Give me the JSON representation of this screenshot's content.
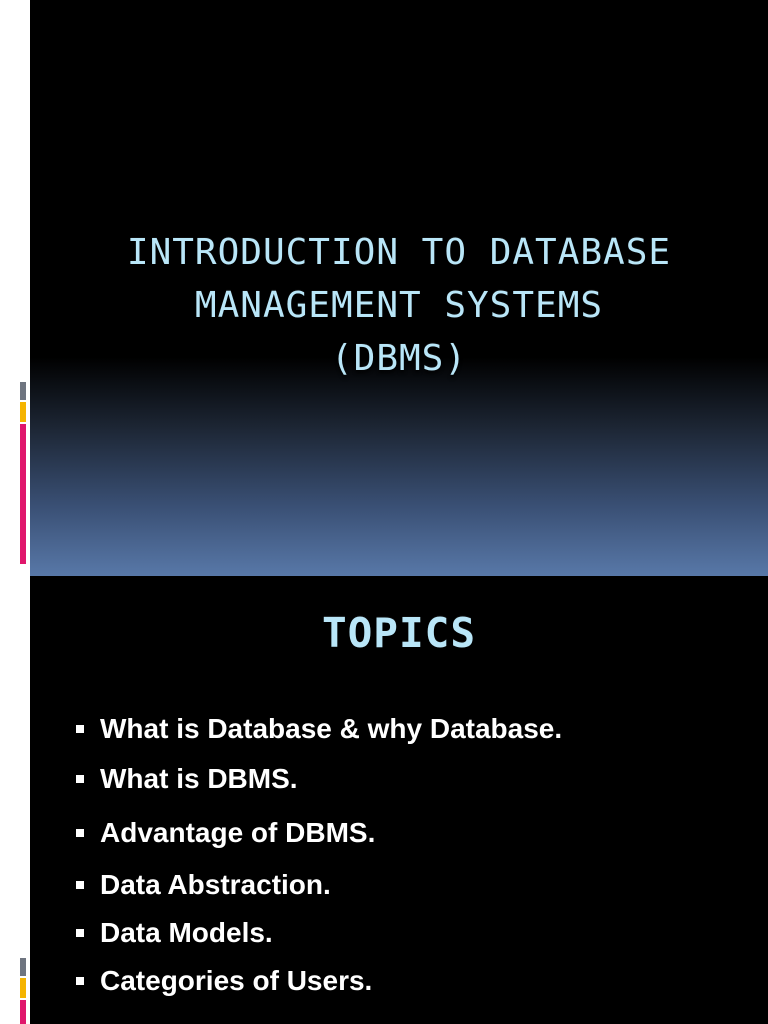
{
  "slides": [
    {
      "title_lines": [
        "INTRODUCTION TO DATABASE",
        "MANAGEMENT SYSTEMS",
        "(DBMS)"
      ]
    },
    {
      "title": "TOPICS",
      "bullets": [
        "What is Database & why Database.",
        "What is DBMS.",
        "Advantage of DBMS.",
        "Data Abstraction.",
        "Data Models.",
        "Categories of Users."
      ]
    }
  ],
  "colors": {
    "title_text": "#b9e6f8",
    "slide_background": "#000000",
    "gradient_bottom": "#5878a8",
    "edge_pink": "#e0176c",
    "edge_yellow": "#f5b400",
    "edge_gray": "#6f7580"
  },
  "icons": [
    "square-bullet-icon"
  ]
}
